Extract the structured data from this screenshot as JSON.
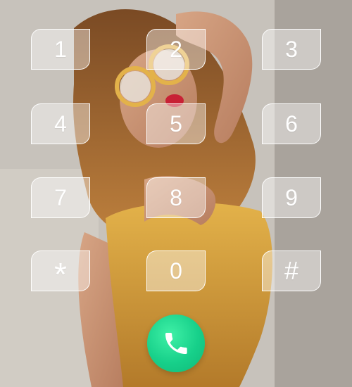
{
  "keypad": {
    "keys": [
      "1",
      "2",
      "3",
      "4",
      "5",
      "6",
      "7",
      "8",
      "9",
      "*",
      "0",
      "#"
    ]
  },
  "call": {
    "icon": "phone-icon",
    "color": "#19d38c"
  },
  "background": {
    "description_colors": [
      "#c9c4bd",
      "#a86c2f",
      "#e7b24f"
    ]
  }
}
